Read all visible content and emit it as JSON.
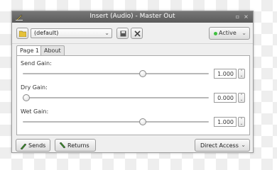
{
  "window": {
    "title": "Insert (Audio) - Master Out"
  },
  "toolbar": {
    "preset_value": "(default)",
    "active_label": "Active"
  },
  "tabs": [
    {
      "label": "Page 1",
      "active": true
    },
    {
      "label": "About",
      "active": false
    }
  ],
  "controls": [
    {
      "label": "Send Gain:",
      "value": "1.000",
      "position_fraction": 0.65
    },
    {
      "label": "Dry Gain:",
      "value": "0.000",
      "position_fraction": 0.0
    },
    {
      "label": "Wet Gain:",
      "value": "1.000",
      "position_fraction": 0.65
    }
  ],
  "bottom": {
    "sends_label": "Sends",
    "returns_label": "Returns",
    "direct_access_label": "Direct Access"
  },
  "colors": {
    "active_indicator": "#3fbf3f",
    "titlebar": "#666666"
  }
}
